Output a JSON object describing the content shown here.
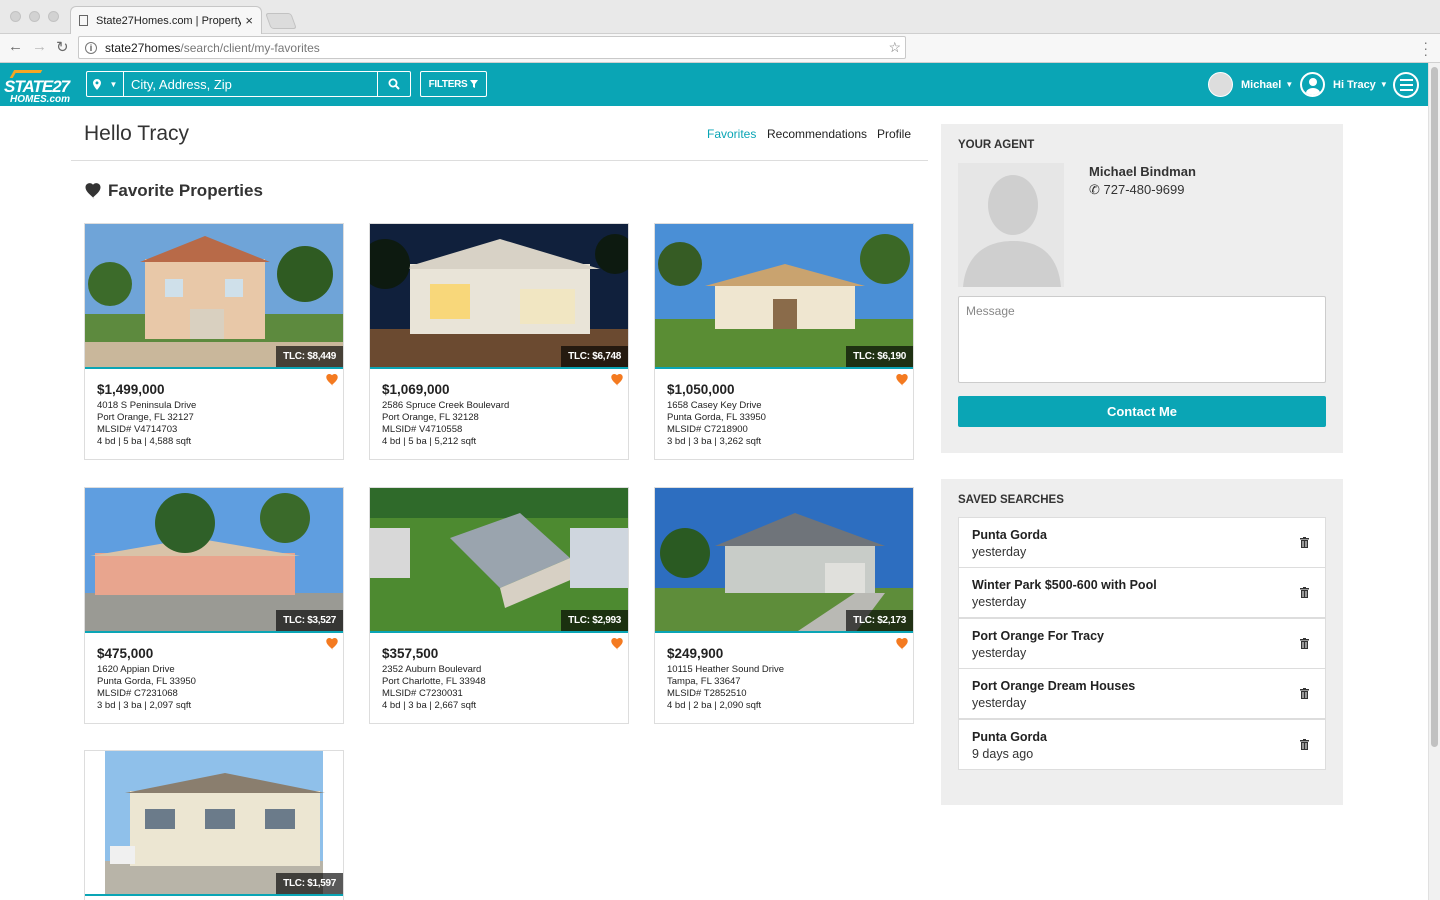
{
  "browser": {
    "tab_title": "State27Homes.com | Property",
    "url_host": "state27homes",
    "url_path": "/search/client/my-favorites"
  },
  "header": {
    "logo_line1": "STATE27",
    "logo_line2": "HOMES.com",
    "search_placeholder": "City, Address, Zip",
    "filters_label": "FILTERS",
    "agent_menu_label": "Michael",
    "user_menu_label": "Hi Tracy",
    "brand_color": "#0aa5b5",
    "accent_color": "#f47a20"
  },
  "page": {
    "greeting": "Hello Tracy",
    "tabs": [
      "Favorites",
      "Recommendations",
      "Profile"
    ],
    "active_tab": "Favorites",
    "favorites_heading": "Favorite Properties"
  },
  "properties": [
    {
      "tlc": "TLC: $8,449",
      "price": "$1,499,000",
      "address": "4018 S Peninsula Drive",
      "city": "Port Orange, FL 32127",
      "mls": "MLSID# V4714703",
      "details": "4 bd | 5 ba | 4,588 sqft"
    },
    {
      "tlc": "TLC: $6,748",
      "price": "$1,069,000",
      "address": "2586 Spruce Creek Boulevard",
      "city": "Port Orange, FL 32128",
      "mls": "MLSID# V4710558",
      "details": "4 bd | 5 ba | 5,212 sqft"
    },
    {
      "tlc": "TLC: $6,190",
      "price": "$1,050,000",
      "address": "1658 Casey Key Drive",
      "city": "Punta Gorda, FL 33950",
      "mls": "MLSID# C7218900",
      "details": "3 bd | 3 ba | 3,262 sqft"
    },
    {
      "tlc": "TLC: $3,527",
      "price": "$475,000",
      "address": "1620 Appian Drive",
      "city": "Punta Gorda, FL 33950",
      "mls": "MLSID# C7231068",
      "details": "3 bd | 3 ba | 2,097 sqft"
    },
    {
      "tlc": "TLC: $2,993",
      "price": "$357,500",
      "address": "2352 Auburn Boulevard",
      "city": "Port Charlotte, FL 33948",
      "mls": "MLSID# C7230031",
      "details": "4 bd | 3 ba | 2,667 sqft"
    },
    {
      "tlc": "TLC: $2,173",
      "price": "$249,900",
      "address": "10115 Heather Sound Drive",
      "city": "Tampa, FL 33647",
      "mls": "MLSID# T2852510",
      "details": "4 bd | 2 ba | 2,090 sqft"
    },
    {
      "tlc": "TLC: $1,597"
    }
  ],
  "agent": {
    "heading": "YOUR AGENT",
    "name": "Michael Bindman",
    "phone": "727-480-9699",
    "message_placeholder": "Message",
    "contact_label": "Contact Me"
  },
  "saved_searches": {
    "heading": "SAVED SEARCHES",
    "items": [
      {
        "name": "Punta Gorda",
        "date": "yesterday"
      },
      {
        "name": "Winter Park $500-600 with Pool",
        "date": "yesterday"
      },
      {
        "name": "Port Orange For Tracy",
        "date": "yesterday"
      },
      {
        "name": "Port Orange Dream Houses",
        "date": "yesterday"
      },
      {
        "name": "Punta Gorda",
        "date": "9 days ago"
      }
    ]
  }
}
